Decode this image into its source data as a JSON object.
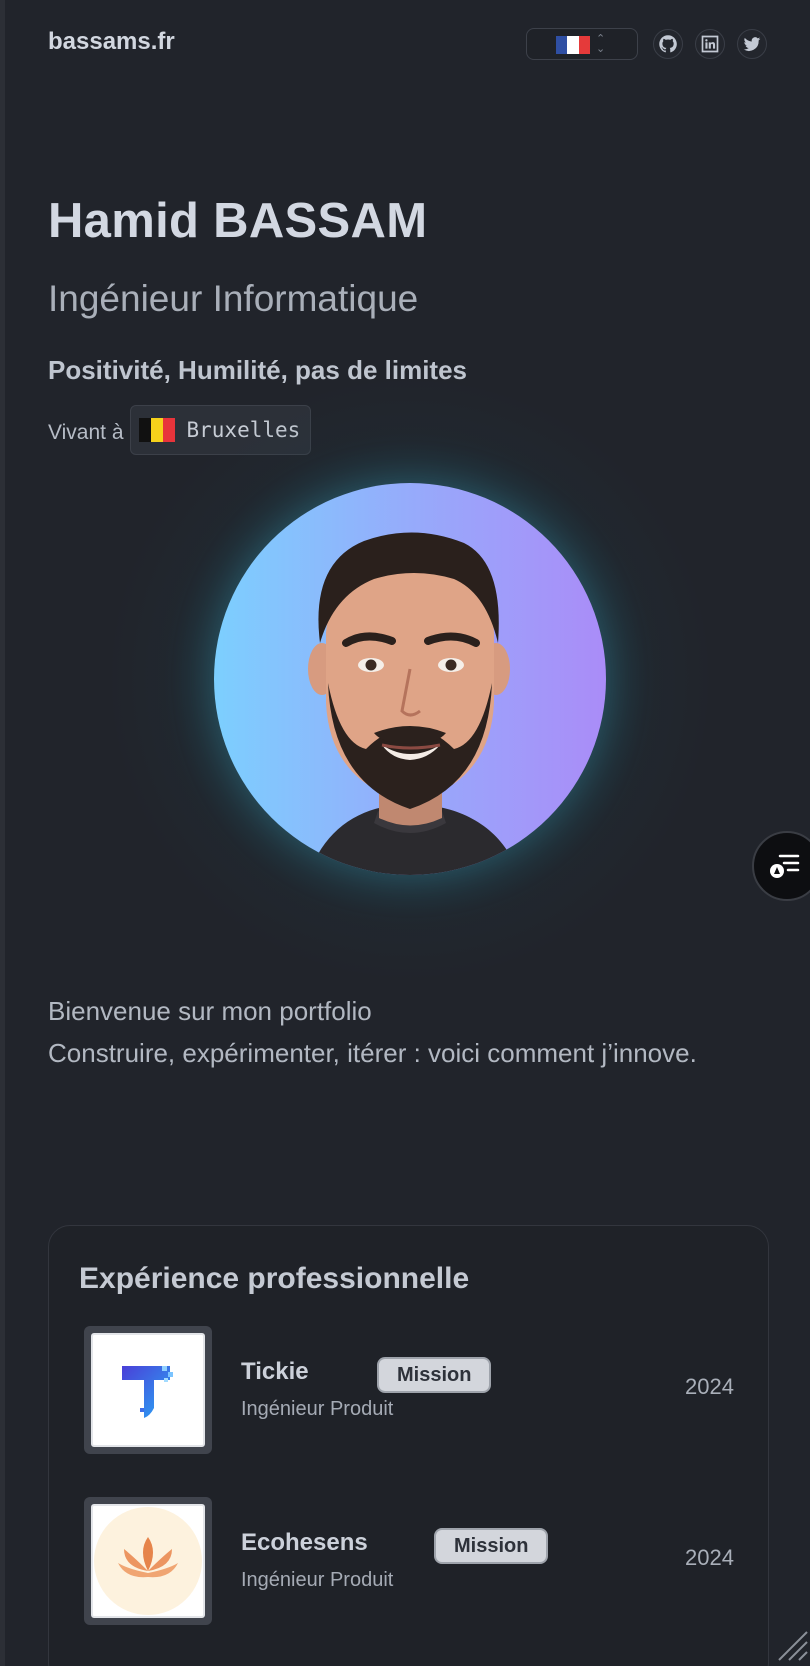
{
  "header": {
    "brand": "bassams.fr",
    "language_flag": [
      "#2f4fa3",
      "#ffffff",
      "#e53a3a"
    ],
    "social": [
      "github-icon",
      "linkedin-icon",
      "twitter-icon"
    ]
  },
  "hero": {
    "name": "Hamid BASSAM",
    "title": "Ingénieur Informatique",
    "motto": "Positivité, Humilité, pas de limites",
    "living_label": "Vivant à",
    "city": "Bruxelles",
    "city_flag": [
      "#111111",
      "#f6d21b",
      "#e8343b"
    ]
  },
  "intro": {
    "line1": "Bienvenue sur mon portfolio",
    "line2": "Construire, expérimenter, itérer : voici comment j’innove."
  },
  "experience": {
    "title": "Expérience professionnelle",
    "items": [
      {
        "company": "Tickie",
        "badge": "Mission",
        "role": "Ingénieur Produit",
        "year": "2024"
      },
      {
        "company": "Ecohesens",
        "badge": "Mission",
        "role": "Ingénieur Produit",
        "year": "2024"
      }
    ]
  },
  "colors": {
    "background": "#21242b",
    "avatar_gradient": [
      "#7ccffe",
      "#aa8cf8"
    ],
    "glow": "#1d7880"
  }
}
